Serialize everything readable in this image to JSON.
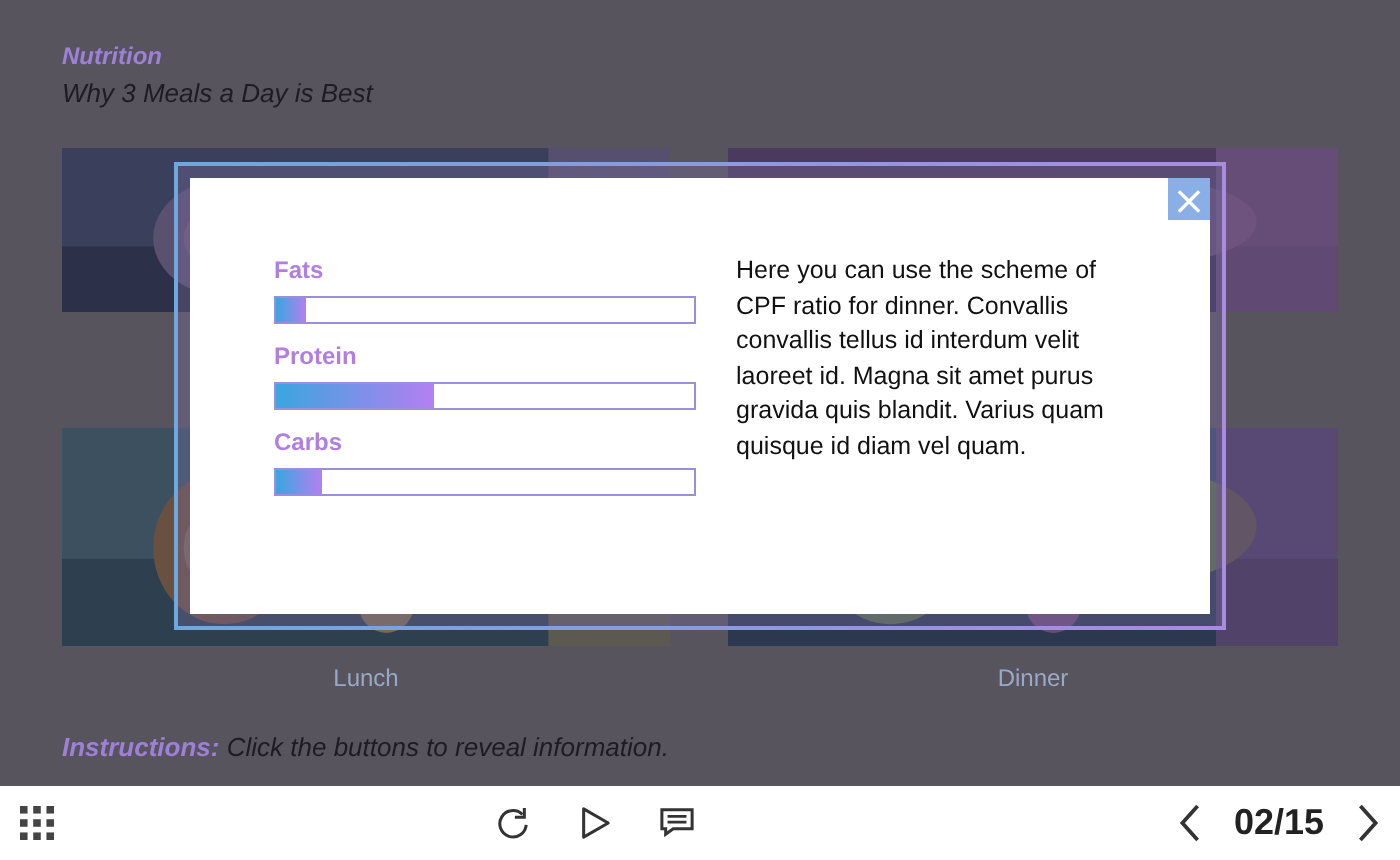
{
  "slide": {
    "section": "Nutrition",
    "title": "Why 3 Meals a Day is Best",
    "tiles": [
      {
        "kind": "picture"
      },
      {
        "kind": "picture"
      },
      {
        "kind": "picture",
        "label": "Lunch"
      },
      {
        "kind": "picture",
        "label": "Dinner"
      }
    ],
    "instructions": {
      "label": "Instructions:",
      "text": "Click the buttons to reveal information."
    }
  },
  "modal": {
    "close": "×",
    "bars": [
      {
        "label": "Fats",
        "level": 0.07
      },
      {
        "label": "Protein",
        "level": 0.38
      },
      {
        "label": "Carbs",
        "level": 0.11
      }
    ],
    "text": "Here you can use the scheme of CPF ratio for dinner. Convallis convallis tellus id interdum velit laoreet id. Magna sit amet purus gravida quis blandit. Varius quam quisque id diam vel quam."
  },
  "player": {
    "page": "02/15"
  }
}
